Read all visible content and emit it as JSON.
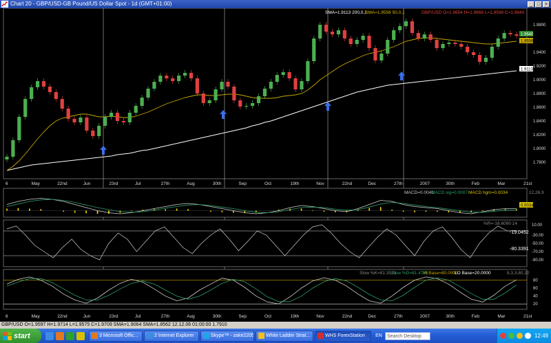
{
  "window": {
    "title": "Chart 20 - GBP/USD-GB Pound/US Dollar Spot - 1d (GMT+01:00)",
    "buttons": {
      "minimize": "_",
      "maximize": "□",
      "close": "×"
    }
  },
  "main_panel": {
    "header_sma200": "SMA=1.9113  200,0,1",
    "header_sma50": "SMA=1.9556  50,0,1",
    "header_ohlc": "GBP/USD O=1.9654 H=1.9666 L=1.9598 C=1.9640",
    "price_axis": [
      "1.9800",
      "1.9400",
      "1.9200",
      "1.9000",
      "1.8800",
      "1.8600",
      "1.8400",
      "1.8200",
      "1.8000",
      "1.7800"
    ],
    "price_tags": {
      "close": "1.9640",
      "sma50": "1.9556",
      "sma200": "1.9113"
    },
    "date_axis": [
      "6",
      "May",
      "22nd",
      "Jun",
      "23rd",
      "Jul",
      "27th",
      "Aug",
      "30th",
      "Sep",
      "Oct",
      "19th",
      "Nov",
      "22nd",
      "Dec",
      "27th",
      "2007",
      "30th",
      "Feb",
      "Mar",
      "21st"
    ]
  },
  "chart_data": [
    {
      "type": "line",
      "title": "GBP/USD",
      "series": [
        {
          "name": "GBP/USD",
          "values": [
            1.788,
            1.812,
            1.846,
            1.872,
            1.889,
            1.898,
            1.89,
            1.882,
            1.872,
            1.858,
            1.843,
            1.838,
            1.845,
            1.826,
            1.818,
            1.833,
            1.846,
            1.852,
            1.84,
            1.838,
            1.852,
            1.862,
            1.874,
            1.887,
            1.897,
            1.906,
            1.902,
            1.898,
            1.906,
            1.91,
            1.902,
            1.88,
            1.866,
            1.87,
            1.886,
            1.897,
            1.89,
            1.87,
            1.861,
            1.862,
            1.866,
            1.876,
            1.887,
            1.897,
            1.907,
            1.911,
            1.902,
            1.886,
            1.898,
            1.927,
            1.96,
            1.98,
            1.97,
            1.966,
            1.972,
            1.96,
            1.952,
            1.958,
            1.964,
            1.946,
            1.928,
            1.938,
            1.958,
            1.972,
            1.978,
            1.985,
            1.968,
            1.96,
            1.966,
            1.958,
            1.946,
            1.952,
            1.954,
            1.952,
            1.948,
            1.94,
            1.936,
            1.926,
            1.932,
            1.948,
            1.96,
            1.968,
            1.966,
            1.964
          ]
        },
        {
          "name": "SMA 50",
          "values": [
            1.768,
            1.774,
            1.782,
            1.792,
            1.803,
            1.814,
            1.824,
            1.833,
            1.84,
            1.844,
            1.846,
            1.848,
            1.85,
            1.85,
            1.848,
            1.846,
            1.846,
            1.847,
            1.846,
            1.845,
            1.845,
            1.847,
            1.85,
            1.853,
            1.857,
            1.861,
            1.865,
            1.868,
            1.871,
            1.874,
            1.876,
            1.878,
            1.878,
            1.877,
            1.877,
            1.878,
            1.879,
            1.879,
            1.878,
            1.876,
            1.874,
            1.873,
            1.873,
            1.873,
            1.874,
            1.876,
            1.877,
            1.878,
            1.88,
            1.885,
            1.892,
            1.9,
            1.906,
            1.912,
            1.918,
            1.923,
            1.927,
            1.931,
            1.935,
            1.938,
            1.94,
            1.942,
            1.945,
            1.948,
            1.952,
            1.956,
            1.958,
            1.96,
            1.961,
            1.961,
            1.96,
            1.959,
            1.958,
            1.957,
            1.956,
            1.955,
            1.954,
            1.953,
            1.952,
            1.952,
            1.953,
            1.954,
            1.955,
            1.956
          ]
        },
        {
          "name": "SMA 200",
          "values": [
            1.768,
            1.77,
            1.772,
            1.774,
            1.776,
            1.777,
            1.778,
            1.779,
            1.78,
            1.781,
            1.782,
            1.783,
            1.784,
            1.785,
            1.786,
            1.787,
            1.788,
            1.789,
            1.791,
            1.792,
            1.793,
            1.795,
            1.797,
            1.798,
            1.8,
            1.802,
            1.804,
            1.806,
            1.808,
            1.81,
            1.812,
            1.814,
            1.816,
            1.818,
            1.82,
            1.822,
            1.824,
            1.826,
            1.828,
            1.83,
            1.833,
            1.835,
            1.838,
            1.84,
            1.843,
            1.846,
            1.849,
            1.852,
            1.855,
            1.858,
            1.861,
            1.864,
            1.867,
            1.87,
            1.873,
            1.876,
            1.879,
            1.882,
            1.884,
            1.886,
            1.888,
            1.89,
            1.892,
            1.893,
            1.894,
            1.895,
            1.896,
            1.897,
            1.898,
            1.899,
            1.9,
            1.901,
            1.902,
            1.903,
            1.904,
            1.905,
            1.906,
            1.907,
            1.908,
            1.909,
            1.91,
            1.911,
            1.912,
            1.913
          ]
        }
      ],
      "ylim": [
        1.76,
        1.99
      ],
      "annotations": "up-arrows at Jun, Sep, Nov, Jan",
      "grid": false
    },
    {
      "type": "line",
      "title": "MACD",
      "series": [
        {
          "name": "MACD",
          "values": [
            0.012,
            0.018,
            0.022,
            0.024,
            0.022,
            0.018,
            0.012,
            0.006,
            0.0,
            -0.004,
            -0.006,
            -0.004,
            0.0,
            0.004,
            0.008,
            0.012,
            0.014,
            0.012,
            0.008,
            0.004,
            0.0,
            -0.004,
            -0.006,
            -0.004,
            0.0,
            0.006,
            0.01,
            0.008,
            0.004,
            0.0,
            -0.002,
            0.004,
            0.012,
            0.02,
            0.018,
            0.012,
            0.008,
            0.006,
            0.004,
            0.0,
            -0.004,
            -0.006,
            -0.002,
            0.002,
            0.004,
            0.004
          ]
        },
        {
          "name": "MACD sig",
          "values": [
            0.008,
            0.013,
            0.018,
            0.021,
            0.022,
            0.02,
            0.016,
            0.011,
            0.006,
            0.002,
            -0.002,
            -0.003,
            -0.002,
            0.001,
            0.005,
            0.008,
            0.011,
            0.012,
            0.01,
            0.007,
            0.004,
            0.0,
            -0.003,
            -0.004,
            -0.002,
            0.002,
            0.006,
            0.007,
            0.006,
            0.003,
            0.001,
            0.002,
            0.007,
            0.013,
            0.016,
            0.014,
            0.011,
            0.008,
            0.006,
            0.003,
            0.0,
            -0.003,
            -0.003,
            -0.001,
            0.001,
            0.001
          ]
        }
      ],
      "ylim": [
        -0.01,
        0.03
      ],
      "labels": {
        "macd": "MACD=0.0041",
        "signal": "MACD sig=0.0007",
        "histogram": "MACD hgm=0.0034",
        "axis": "12,26,9",
        "tag": "0.0034"
      }
    },
    {
      "type": "line",
      "title": "%R",
      "series": [
        {
          "name": "%R",
          "values": [
            -15,
            -8,
            -30,
            -55,
            -70,
            -85,
            -60,
            -40,
            -65,
            -80,
            -90,
            -50,
            -25,
            -40,
            -70,
            -45,
            -20,
            -10,
            -35,
            -60,
            -75,
            -50,
            -30,
            -15,
            -40,
            -68,
            -45,
            -20,
            -30,
            -55,
            -80,
            -55,
            -30,
            -10,
            -5,
            -25,
            -50,
            -70,
            -85,
            -60,
            -35,
            -15,
            -30,
            -55,
            -80,
            -45,
            -20,
            -10,
            -35,
            -65,
            -85,
            -50,
            -25,
            -8,
            -20,
            -19
          ]
        }
      ],
      "ylim": [
        -100,
        0
      ],
      "labels": {
        "params": "%R=-16.6090  14",
        "value_tag": "-19.0452",
        "trend_tag": "-80.3391"
      },
      "axis_ticks": [
        "10.00",
        "-30.00",
        "-50.00",
        "-70.00",
        "-90.00"
      ]
    },
    {
      "type": "line",
      "title": "Slow Stochastic",
      "series": [
        {
          "name": "Slow %K",
          "values": [
            70,
            82,
            88,
            80,
            65,
            45,
            30,
            22,
            35,
            55,
            72,
            82,
            75,
            58,
            40,
            28,
            35,
            55,
            70,
            85,
            80,
            62,
            40,
            25,
            20,
            38,
            60,
            78,
            86,
            80,
            65,
            45,
            28,
            22,
            40,
            62,
            80,
            88,
            84,
            70,
            50,
            32,
            25,
            42,
            65,
            81
          ]
        },
        {
          "name": "Slow %D",
          "values": [
            65,
            75,
            84,
            84,
            74,
            58,
            42,
            30,
            30,
            42,
            58,
            72,
            78,
            70,
            55,
            40,
            32,
            40,
            55,
            72,
            82,
            76,
            58,
            38,
            26,
            26,
            40,
            60,
            76,
            84,
            78,
            62,
            44,
            30,
            28,
            42,
            62,
            80,
            86,
            80,
            64,
            46,
            32,
            32,
            48,
            68
          ]
        }
      ],
      "ylim": [
        10,
        100
      ],
      "labels": {
        "k": "Slow %K=81.3521",
        "d": "Slow %D=81.4715",
        "hi": "HI Base=80.0000",
        "lo": "LO Base=20.0000",
        "params": "8,3,3,80,20"
      },
      "axis_ticks": [
        "80",
        "60",
        "40",
        "20"
      ]
    }
  ],
  "colors": {
    "background": "#000000",
    "candle_up": "#4caf50",
    "candle_down": "#e04040",
    "sma50": "#c8a800",
    "sma200": "#ffffff",
    "macd": "#ffe000",
    "signal": "#2e9f6a",
    "arrow": "#3a6ee8"
  },
  "statusbar": {
    "text": "GBP/USD O=1.9597 H=1.9714 L=1.9575 C=1.9709  SMA=1.9064  SMA=1.8562  12.12.06  01:00:00  1.7910"
  },
  "taskbar": {
    "start_label": "start",
    "tasks": [
      {
        "label": "3 Microsoft Offic...",
        "icon_color": "#e07a20"
      },
      {
        "label": "2 Internet Explorer",
        "icon_color": "#3a8de0"
      },
      {
        "label": "Skype™ - zake2205",
        "icon_color": "#1fa7e8"
      },
      {
        "label": "White Ladder Strat...",
        "icon_color": "#f0c020"
      },
      {
        "label": "WHS ForexStation",
        "icon_color": "#d03030"
      }
    ],
    "lang": "EN",
    "search_placeholder": "Search Desktop",
    "clock": "12:49"
  }
}
